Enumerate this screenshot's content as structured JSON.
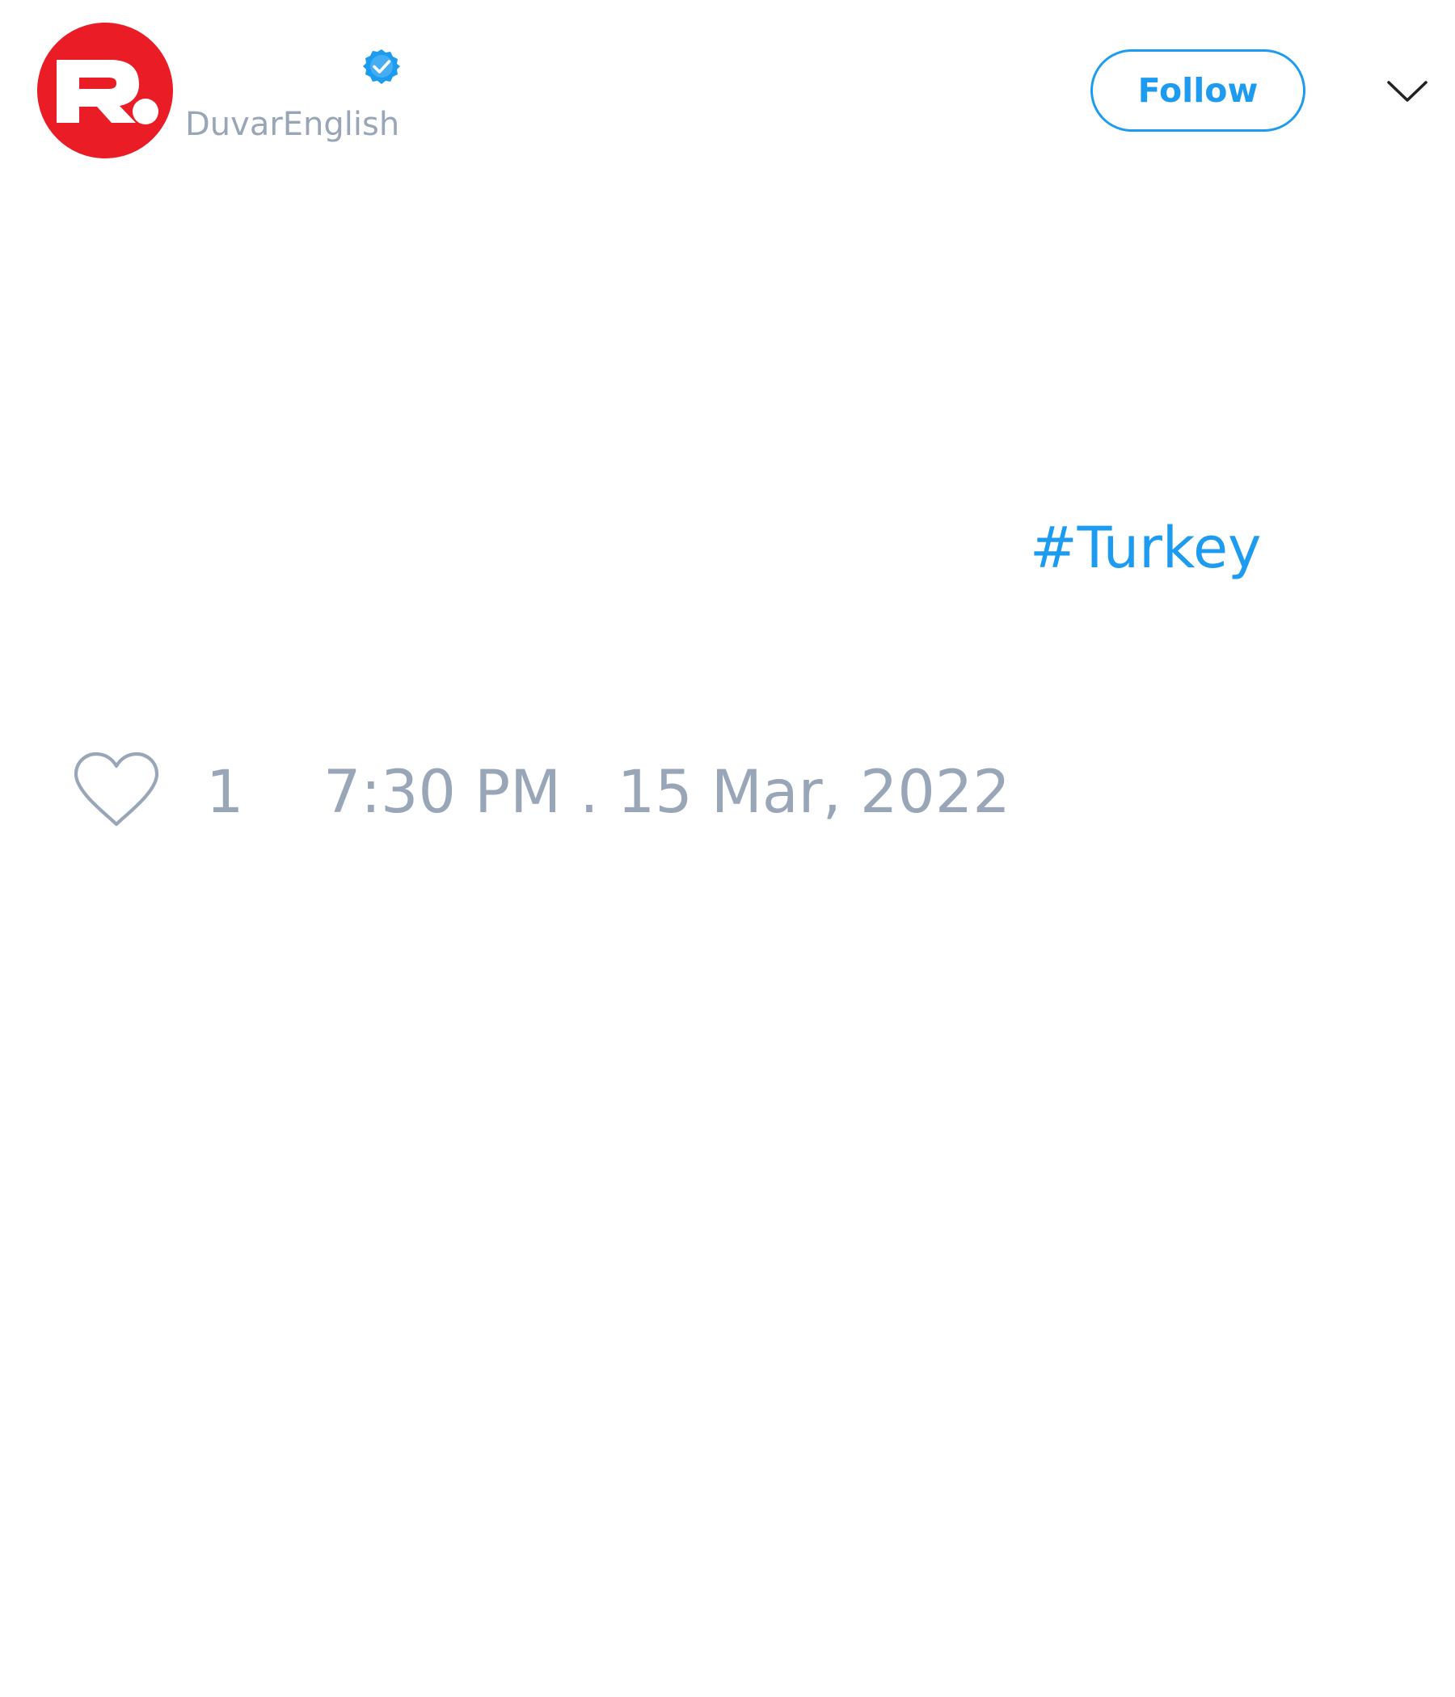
{
  "author": {
    "handle": "DuvarEnglish",
    "avatar_icon": "red-circle-r-logo",
    "avatar_color": "#ea1d27",
    "verified_icon": "verified-badge-icon",
    "verified_color": "#1d9bf0"
  },
  "header": {
    "follow_label": "Follow",
    "menu_icon": "chevron-down-icon"
  },
  "tweet": {
    "hashtag": "#Turkey"
  },
  "actions": {
    "like_icon": "heart-outline-icon",
    "like_count": "1",
    "timestamp": "7:30 PM . 15 Mar, 2022"
  },
  "colors": {
    "accent": "#1d9bf0",
    "muted_text": "#98a6b8",
    "background": "#ffffff"
  }
}
